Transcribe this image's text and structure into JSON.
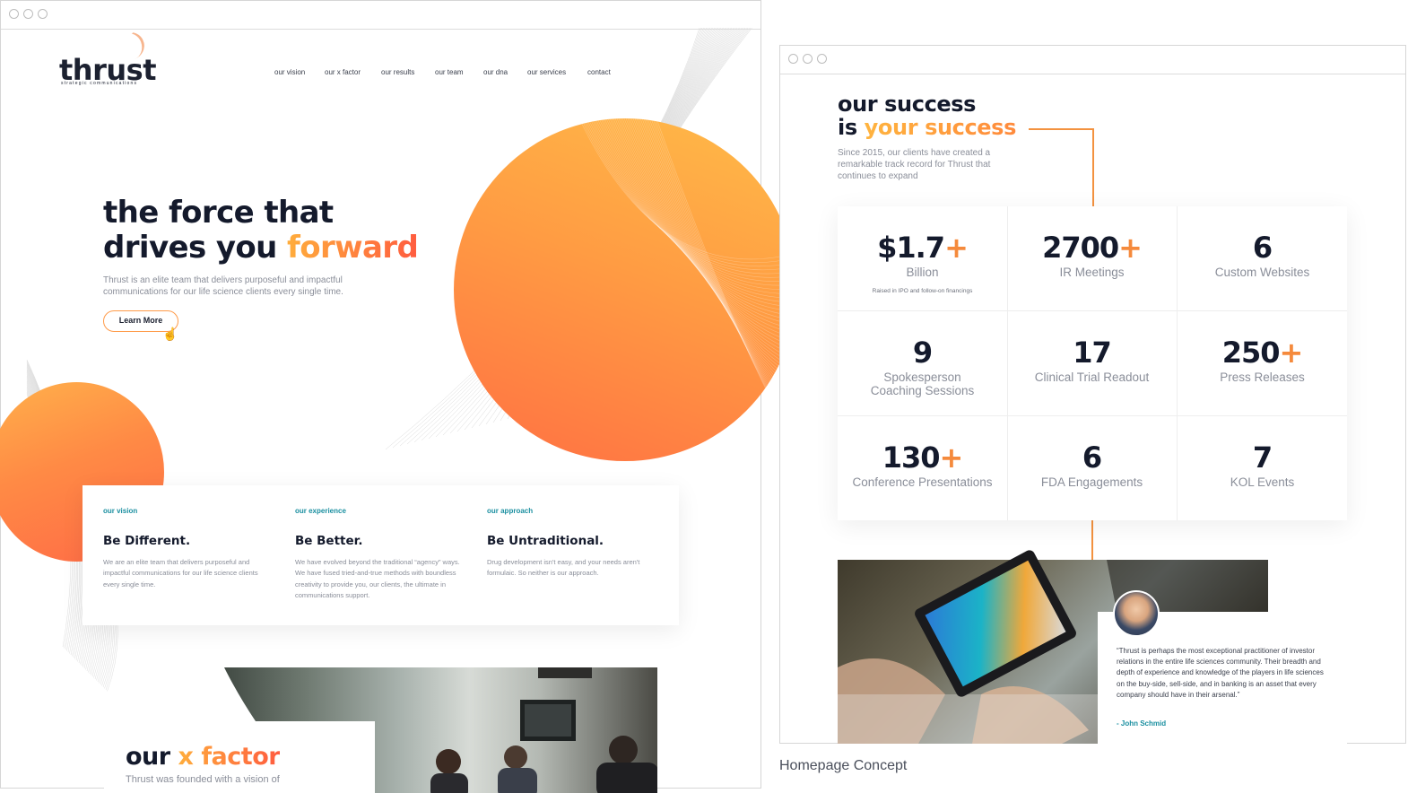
{
  "colors": {
    "accent_orange": "#ff9a48",
    "accent_red": "#ff5c3f",
    "accent_yellow": "#ffb43f",
    "teal": "#1a8fa0",
    "dark": "#141a2c",
    "muted": "#8a8e99"
  },
  "left": {
    "logo": "thrust",
    "logo_tagline": "strategic communications",
    "nav": [
      "our vision",
      "our x factor",
      "our results",
      "our team",
      "our dna",
      "our services",
      "contact"
    ],
    "hero": {
      "line1": "the force that",
      "line2_plain": "drives you ",
      "line2_highlight": "forward",
      "subtitle": "Thrust is an elite team that delivers purposeful and impactful communications for our life science clients every single time.",
      "button": "Learn More"
    },
    "cards": [
      {
        "kicker": "our vision",
        "title": "Be Different.",
        "text": "We are an elite team that delivers purposeful and impactful communications for our life science clients every single time."
      },
      {
        "kicker": "our experience",
        "title": "Be Better.",
        "text": "We have evolved beyond the traditional “agency” ways. We have fused tried-and-true methods with boundless creativity to provide you, our clients, the ultimate in communications support."
      },
      {
        "kicker": "our approach",
        "title": "Be Untraditional.",
        "text": "Drug development isn't easy, and your needs aren't formulaic. So neither is our approach."
      }
    ],
    "xfactor": {
      "plain": "our ",
      "highlight": "x factor",
      "subtitle": "Thrust was founded with a vision of"
    }
  },
  "right": {
    "title_line1": "our success",
    "title_line2_plain": "is ",
    "title_line2_highlight": "your success",
    "subtitle": "Since 2015, our clients have created a remarkable track record for Thrust that continues to expand",
    "stats": [
      {
        "value": "$1.7",
        "plus": "+",
        "label": "Billion",
        "note": "Raised in IPO and follow-on financings"
      },
      {
        "value": "2700",
        "plus": "+",
        "label": "IR Meetings",
        "note": ""
      },
      {
        "value": "6",
        "plus": "",
        "label": "Custom Websites",
        "note": ""
      },
      {
        "value": "9",
        "plus": "",
        "label": "Spokesperson Coaching Sessions",
        "note": ""
      },
      {
        "value": "17",
        "plus": "",
        "label": "Clinical Trial Readout",
        "note": ""
      },
      {
        "value": "250",
        "plus": "+",
        "label": "Press Releases",
        "note": ""
      },
      {
        "value": "130",
        "plus": "+",
        "label": "Conference Presentations",
        "note": ""
      },
      {
        "value": "6",
        "plus": "",
        "label": "FDA Engagements",
        "note": ""
      },
      {
        "value": "7",
        "plus": "",
        "label": "KOL Events",
        "note": ""
      }
    ],
    "quote": {
      "text": "“Thrust is perhaps the most exceptional practitioner of investor relations in the entire life sciences community. Their breadth and depth of experience and knowledge of the players in life sciences on the buy-side, sell-side, and in banking is an asset that every company should have in their arsenal.”",
      "author": "- John Schmid"
    }
  },
  "caption": "Homepage Concept",
  "icons": {
    "cursor": "pointer-hand-icon",
    "window_dots": "window-control-icon"
  }
}
